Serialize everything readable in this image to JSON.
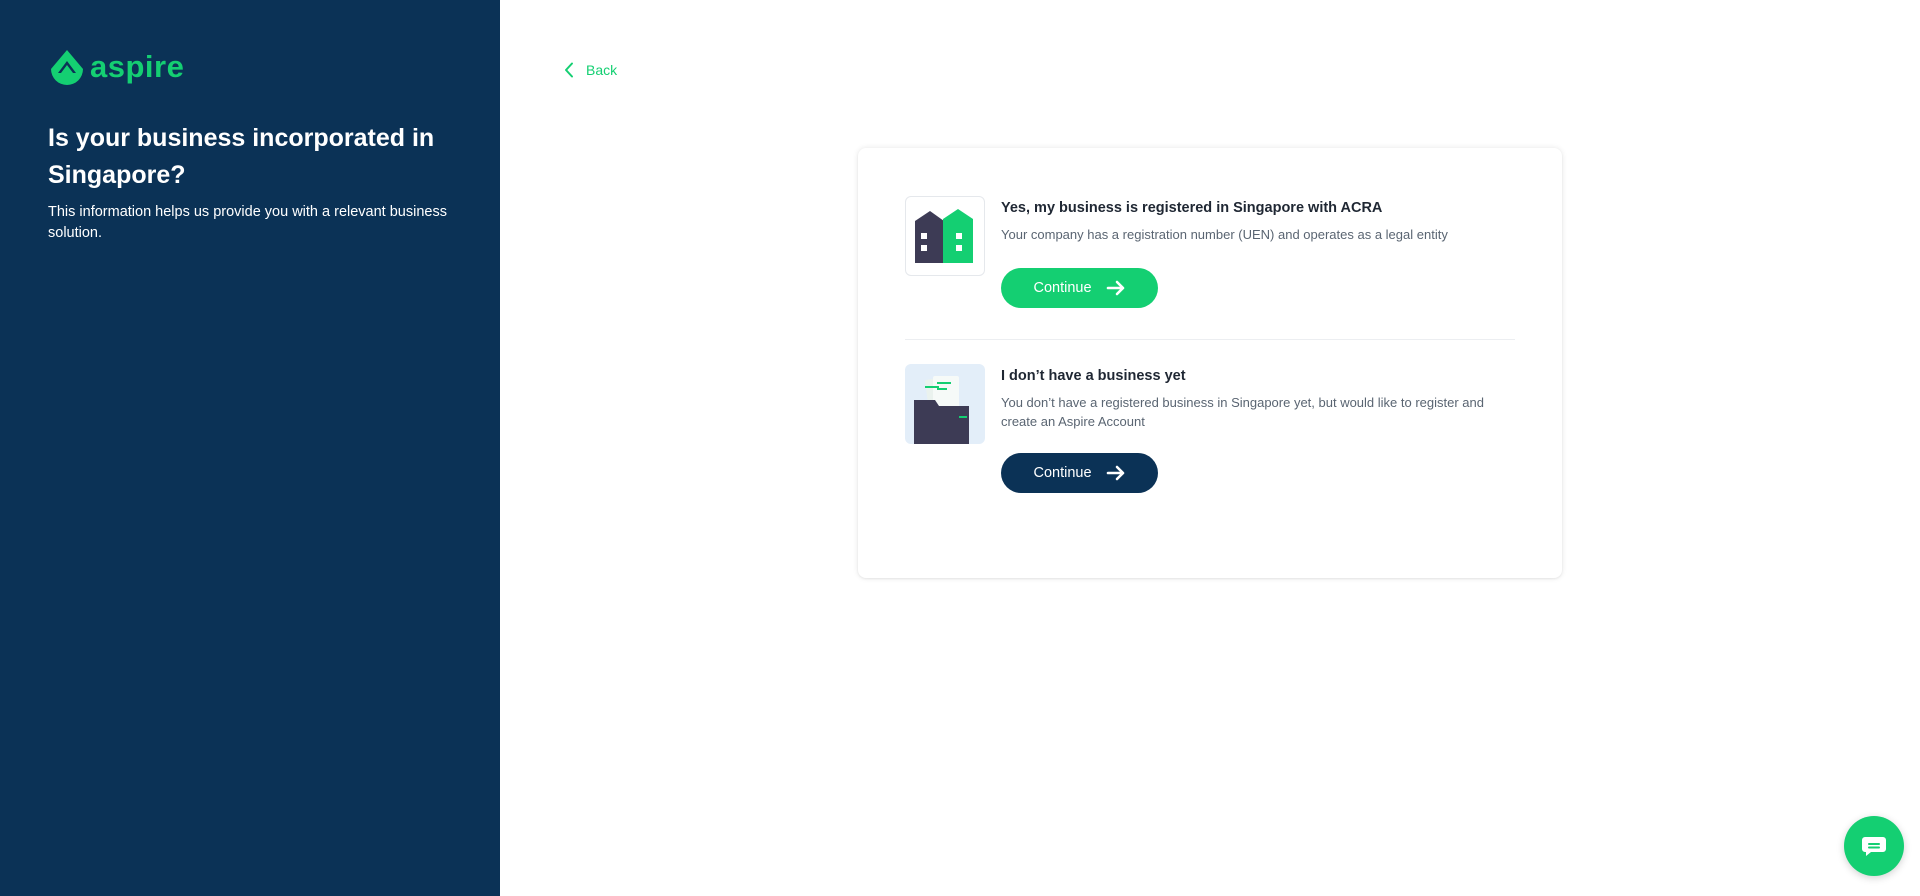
{
  "brand": {
    "name": "aspire",
    "accent": "#14cf72",
    "navy": "#0b3256"
  },
  "sidebar": {
    "title": "Is your business incorporated in Singapore?",
    "subtitle": "This information helps us provide you with a relevant business solution."
  },
  "nav": {
    "back_label": "Back",
    "back_icon": "chevron-left-icon"
  },
  "options": [
    {
      "icon": "building-icon",
      "title": "Yes, my business is registered in Singapore with ACRA",
      "description": "Your company has a registration number (UEN) and operates as a legal entity",
      "button_label": "Continue",
      "button_color": "#14cf72"
    },
    {
      "icon": "folder-documents-icon",
      "title": "I don’t have a business yet",
      "description": "You don’t have a registered business in Singapore yet, but would like to register and create an Aspire Account",
      "button_label": "Continue",
      "button_color": "#0b3256"
    }
  ],
  "chat": {
    "icon": "chat-icon"
  }
}
